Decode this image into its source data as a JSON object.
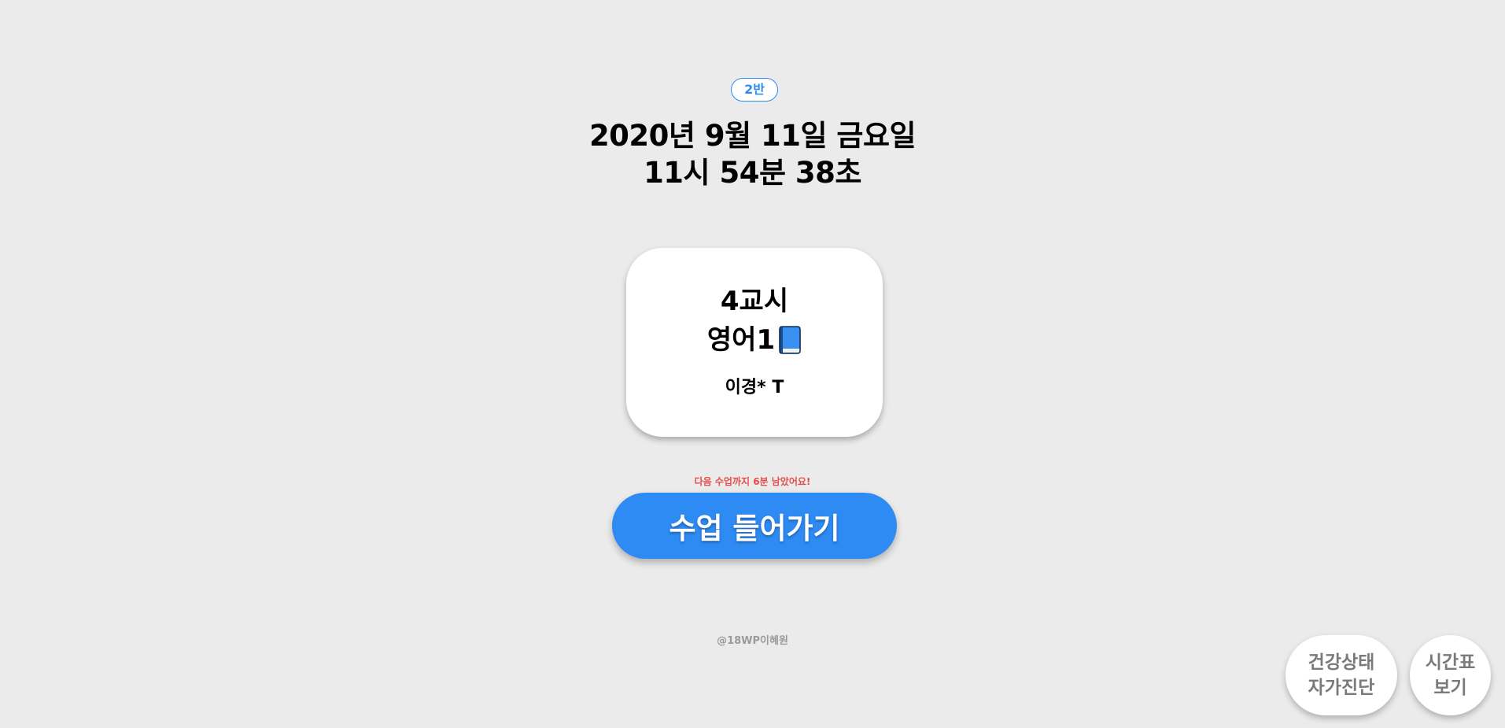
{
  "class_badge": "2반",
  "date_line": "2020년 9월 11일 금요일",
  "time_line": "11시 54분 38초",
  "period_card": {
    "period": "4교시",
    "subject": "영어1",
    "subject_icon": "blue-book-icon",
    "teacher": "이경* T"
  },
  "notice": "다음 수업까지 6분 남았어요!",
  "enter_button_label": "수업 들어가기",
  "credit": "@18WP이혜원",
  "health_button": {
    "line1": "건강상태",
    "line2": "자가진단"
  },
  "timetable_button": {
    "line1": "시간표",
    "line2": "보기"
  },
  "colors": {
    "background": "#ebebeb",
    "accent": "#2e8bf3",
    "notice": "#e84c4c",
    "card": "#ffffff",
    "circle_text": "#7a7a7a"
  }
}
